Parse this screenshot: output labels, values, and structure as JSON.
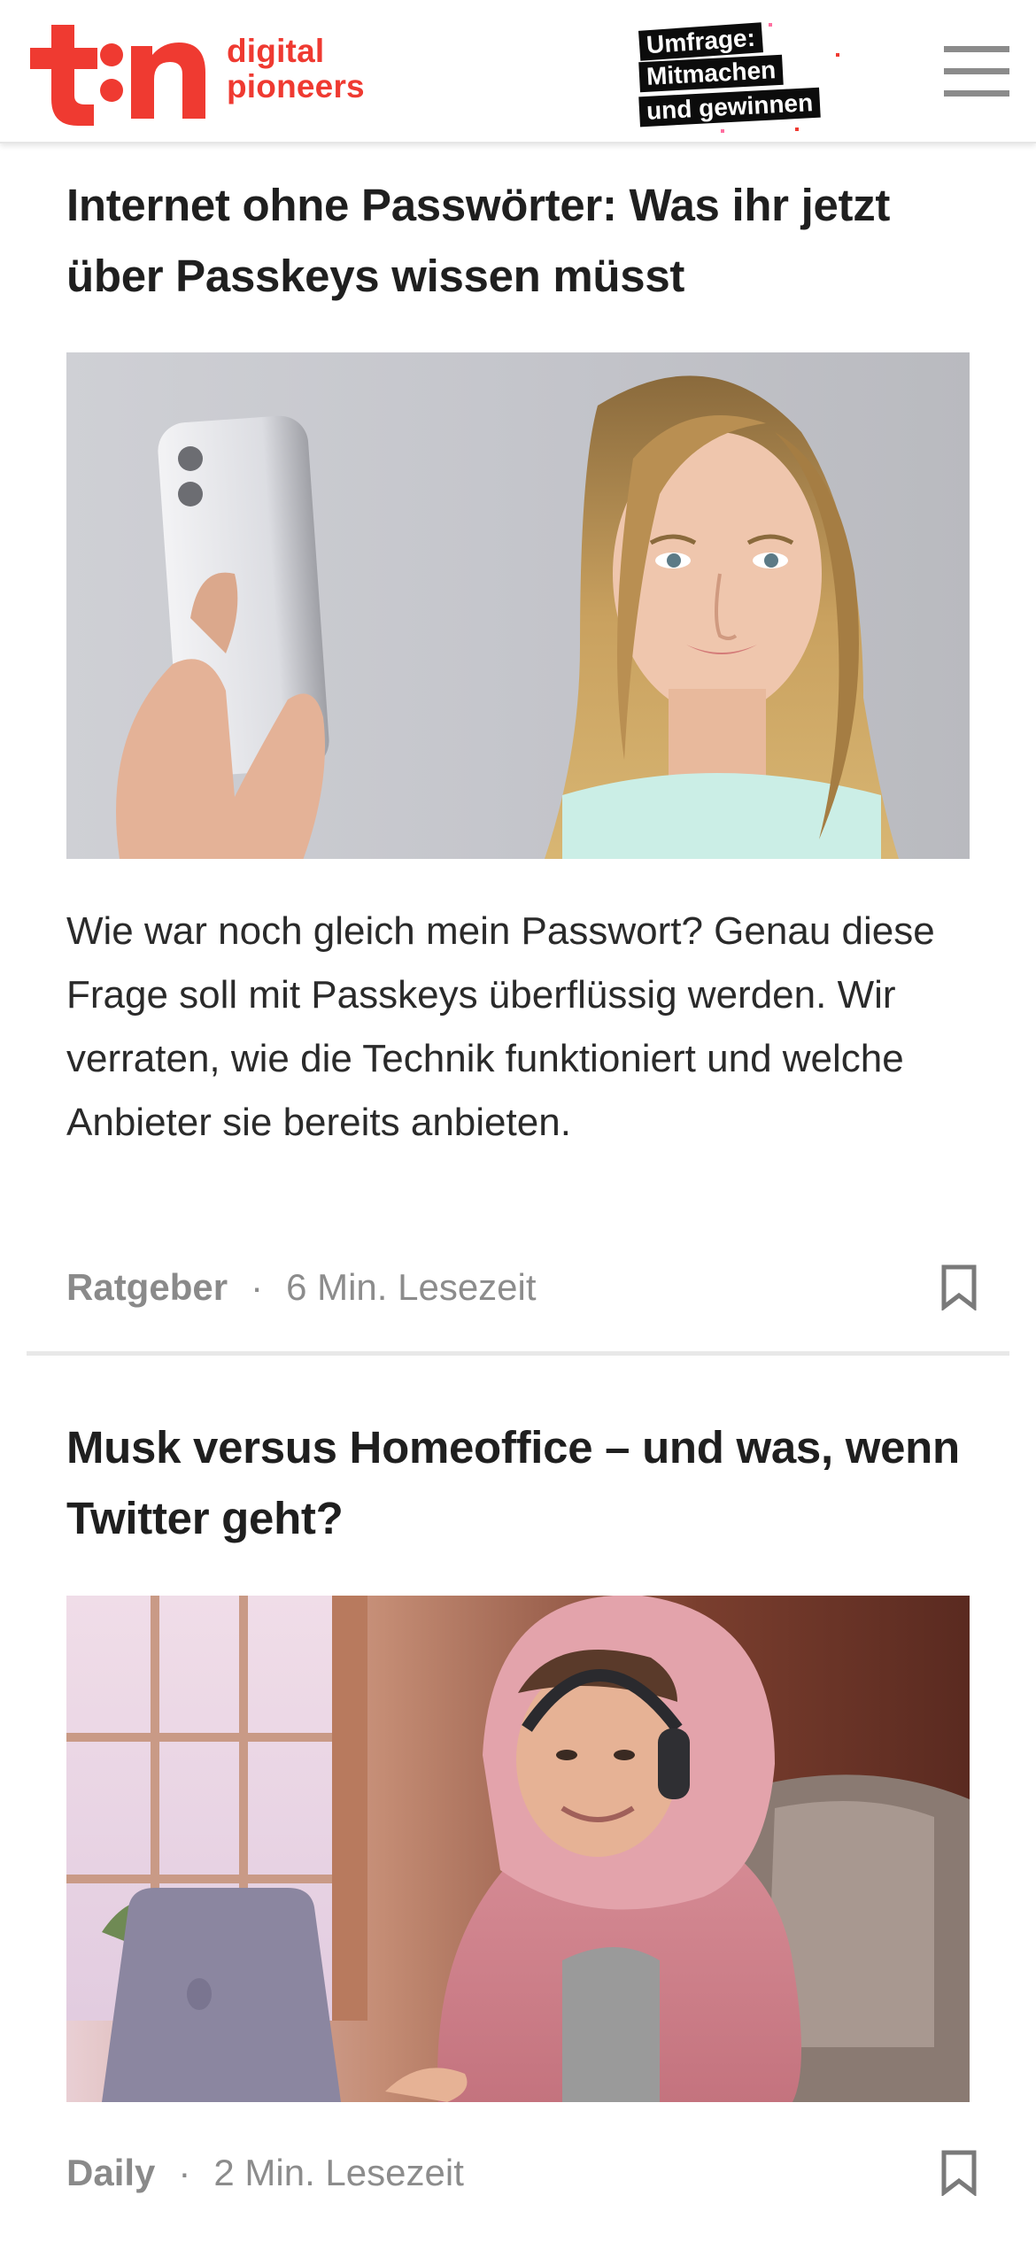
{
  "header": {
    "logo_mark": "t3n",
    "logo_line1": "digital",
    "logo_line2": "pioneers",
    "promo_line1": "Umfrage:",
    "promo_line2": "Mitmachen",
    "promo_line3": "und gewinnen",
    "brand_color": "#ef3a31",
    "menu_icon": "hamburger-menu-icon"
  },
  "articles": [
    {
      "title": "Internet ohne Passwörter: Was ihr jetzt über Passkeys wissen müsst",
      "image": "woman-holding-smartphone-photo",
      "teaser": "Wie war noch gleich mein Passwort? Genau diese Frage soll mit Passkeys überflüssig werden. Wir verraten, wie die Technik funktioniert und welche Anbieter sie bereits anbieten.",
      "category": "Ratgeber",
      "separator": "·",
      "read_time": "6 Min. Lesezeit",
      "bookmark_icon": "bookmark-icon"
    },
    {
      "title": "Musk versus Homeoffice – und was, wenn Twitter geht?",
      "image": "man-in-pink-hoodie-with-laptop-illustration",
      "category": "Daily",
      "separator": "·",
      "read_time": "2 Min. Lesezeit",
      "bookmark_icon": "bookmark-icon"
    }
  ]
}
